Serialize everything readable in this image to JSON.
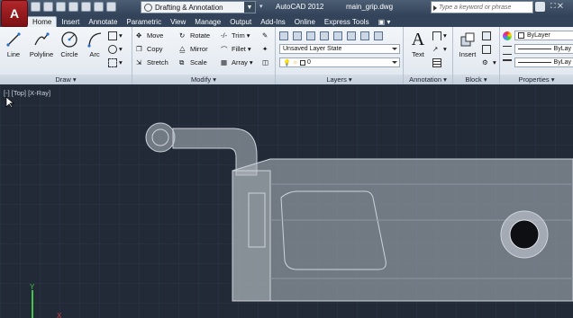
{
  "title_bar": {
    "app_letter": "A",
    "workspace": "Drafting & Annotation",
    "app_name": "AutoCAD 2012",
    "file_name": "main_grip.dwg",
    "search_placeholder": "Type a keyword or phrase"
  },
  "tabs": [
    "Home",
    "Insert",
    "Annotate",
    "Parametric",
    "View",
    "Manage",
    "Output",
    "Add-Ins",
    "Online",
    "Express Tools"
  ],
  "ribbon": {
    "draw": {
      "title": "Draw",
      "line": "Line",
      "polyline": "Polyline",
      "circle": "Circle",
      "arc": "Arc"
    },
    "modify": {
      "title": "Modify",
      "move": "Move",
      "rotate": "Rotate",
      "trim": "Trim",
      "copy": "Copy",
      "mirror": "Mirror",
      "fillet": "Fillet",
      "stretch": "Stretch",
      "scale": "Scale",
      "array": "Array"
    },
    "layers": {
      "title": "Layers",
      "layer_state": "Unsaved Layer State",
      "current_layer": "0"
    },
    "annotation": {
      "title": "Annotation",
      "text": "Text"
    },
    "block": {
      "title": "Block",
      "insert": "Insert"
    },
    "properties": {
      "title": "Properties",
      "color": "ByLayer",
      "linetype": "ByLay",
      "lineweight": "ByLay"
    }
  },
  "viewport": {
    "label": "[-] [Top] [X-Ray]"
  },
  "colors": {
    "accent": "#b1272a",
    "canvas": "#222a37",
    "ribbon": "#e8edf2"
  }
}
